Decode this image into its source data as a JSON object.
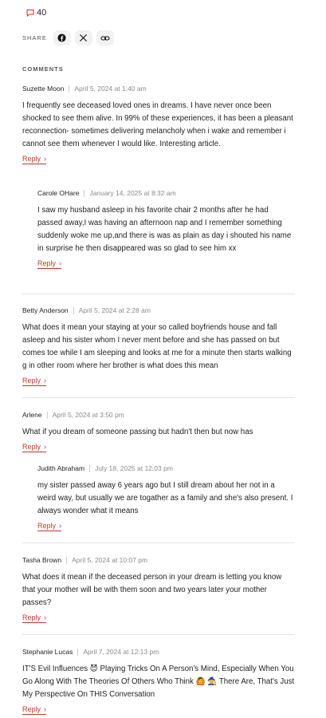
{
  "comment_count": "40",
  "share": {
    "label": "SHARE"
  },
  "comments_heading": "COMMENTS",
  "comments": [
    {
      "author": "Suzette Moon",
      "date": "April 5, 2024 at 1:40 am",
      "body": "I frequently see deceased loved ones in dreams. I have never once been shocked to see them alive. In 99% of these experiences, it has been a pleasant reconnection- sometimes delivering melancholy when i wake and remember i cannot see them whenever I would like. Interesting article.",
      "reply": "Reply"
    },
    {
      "author": "Carole OHare",
      "date": "January 14, 2025 at 8:32 am",
      "body": "I saw my husband asleep in his favorite chair 2 months after he had passed away,I was having an afternoon nap and I remember something suddenly woke me up,and there is was as plain as day i shouted his name in surprise he then disappeared was so glad to see him xx",
      "reply": "Reply"
    },
    {
      "author": "Betty Anderson",
      "date": "April 5, 2024 at 2:28 am",
      "body": "What does it mean your staying at your so called boyfriends house and fall asleep and his sister whom I never ment before and she has passed on but comes toe while I am sleeping and looks at me for a minute then starts walking g in other room where her brother is what does this mean",
      "reply": "Reply"
    },
    {
      "author": "Arlene",
      "date": "April 5, 2024 at 3:50 pm",
      "body": "What if you dream of someone passing but hadn't then but now has",
      "reply": "Reply"
    },
    {
      "author": "Judith Abraham",
      "date": "July 18, 2025 at 12:03 pm",
      "body": "my sister passed away 6 years ago but I still dream about her not in a weird way, but usually we are togather as a family and she's also present. I always wonder what it means",
      "reply": "Reply"
    },
    {
      "author": "Tasha Brown",
      "date": "April 5, 2024 at 10:07 pm",
      "body": "What does it mean if the deceased person in your dream is letting you know that your mother will be with them soon and two years later your mother passes?",
      "reply": "Reply"
    },
    {
      "author": "Stephanie Lucas",
      "date": "April 7, 2024 at 12:13 pm",
      "body": "IT'S Evil Influences 😈 Playing Tricks On A Person's Mind, Especially When You Go Along With The Theories Of Others Who Think 🙆 🧙 There Are, That's Just My Perspective On THIS Conversation",
      "reply": "Reply"
    }
  ]
}
